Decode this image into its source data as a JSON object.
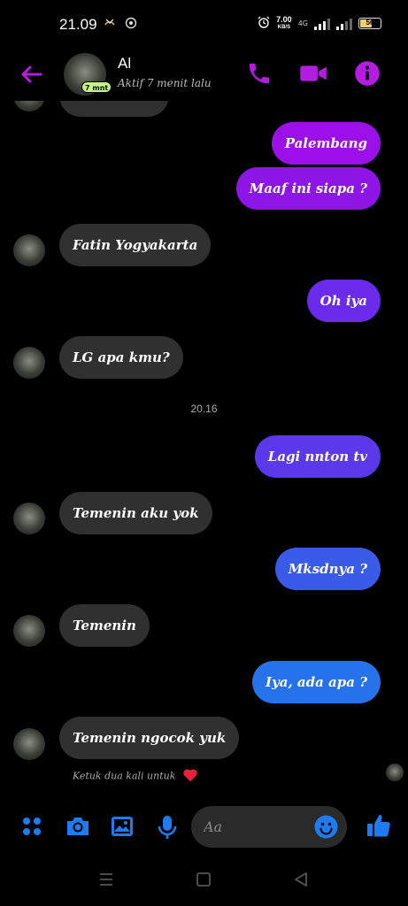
{
  "status_bar": {
    "time": "21.09",
    "speed_value": "7.00",
    "speed_unit": "KB/S",
    "network": "4G",
    "battery": "56"
  },
  "header": {
    "contact_name": "Al",
    "status": "Aktif 7 menit lalu",
    "avatar_badge": "7 mnt"
  },
  "messages": [
    {
      "side": "out",
      "text": "Palembang",
      "color": "#9b10e8"
    },
    {
      "side": "out",
      "text": "Maaf ini siapa ?",
      "color": "#8d15e6"
    },
    {
      "side": "in",
      "text": "Fatin Yogyakarta"
    },
    {
      "side": "out",
      "text": "Oh iya",
      "color": "#6a2bea"
    },
    {
      "side": "in",
      "text": "LG apa kmu?"
    },
    {
      "side": "out",
      "text": "Lagi nnton tv",
      "color": "#5b38ea"
    },
    {
      "side": "in",
      "text": "Temenin aku yok"
    },
    {
      "side": "out",
      "text": "Mksdnya ?",
      "color": "#3a5be8"
    },
    {
      "side": "in",
      "text": "Temenin"
    },
    {
      "side": "out",
      "text": "Iya, ada apa ?",
      "color": "#2672ea"
    },
    {
      "side": "in",
      "text": "Temenin ngocok yuk"
    }
  ],
  "timestamp": "20.16",
  "react_hint": "Ketuk dua kali untuk",
  "composer": {
    "placeholder": "Aa"
  },
  "colors": {
    "accent_purple": "#b41de0",
    "accent_blue": "#1e7cf2",
    "incoming_bubble": "#303030"
  }
}
